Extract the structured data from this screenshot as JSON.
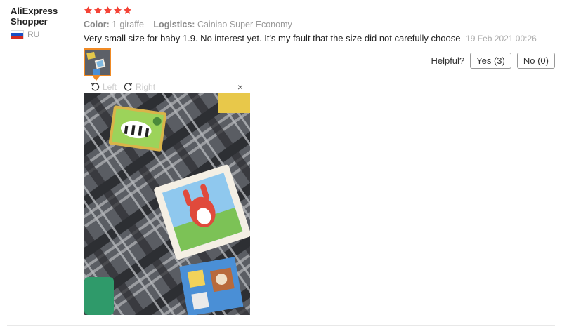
{
  "user": {
    "name": "AliExpress Shopper",
    "country": "RU"
  },
  "review": {
    "rating": 5,
    "color_label": "Color:",
    "color_value": "1-giraffe",
    "logistics_label": "Logistics:",
    "logistics_value": "Cainiao Super Economy",
    "text": "Very small size for baby 1.9. No interest yet. It's my fault that the size did not carefully choose",
    "date": "19 Feb 2021 00:26"
  },
  "helpful": {
    "label": "Helpful?",
    "yes": "Yes (3)",
    "no": "No (0)"
  },
  "viewer": {
    "left": "Left",
    "right": "Right",
    "close": "×"
  },
  "icons": [
    "star-icon",
    "rotate-left-icon",
    "rotate-right-icon",
    "close-icon",
    "flag-icon"
  ],
  "colors": {
    "star": "#f44336",
    "thumb_border": "#f08a24"
  }
}
